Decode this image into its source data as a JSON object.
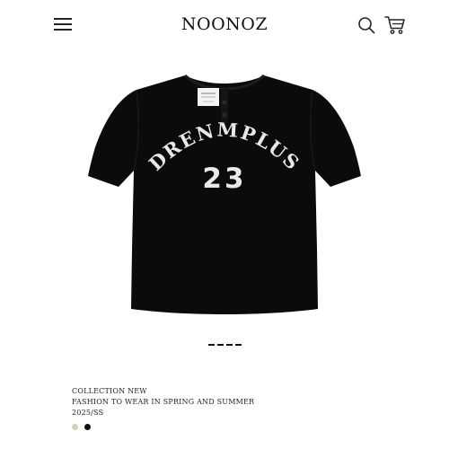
{
  "header": {
    "brand": "NOONOZ",
    "menu_icon": "hamburger-menu-icon",
    "search_icon": "search-icon",
    "cart_icon": "shopping-cart-icon"
  },
  "product": {
    "image_icon": "black-baseball-jersey-tshirt",
    "shirt_text": "DRENMPLUS",
    "shirt_number": "23",
    "shirt_color": "#0b0b0b",
    "print_color": "#e9e9e9"
  },
  "pager": {
    "count": 4
  },
  "description": {
    "line1": "COLLECTION NEW",
    "line2": "FASHION TO WEAR IN SPRING AND SUMMER",
    "line3": "2025/SS"
  },
  "swatches": [
    {
      "name": "beige",
      "color": "#d8cdbf"
    },
    {
      "name": "black",
      "color": "#111111"
    }
  ]
}
